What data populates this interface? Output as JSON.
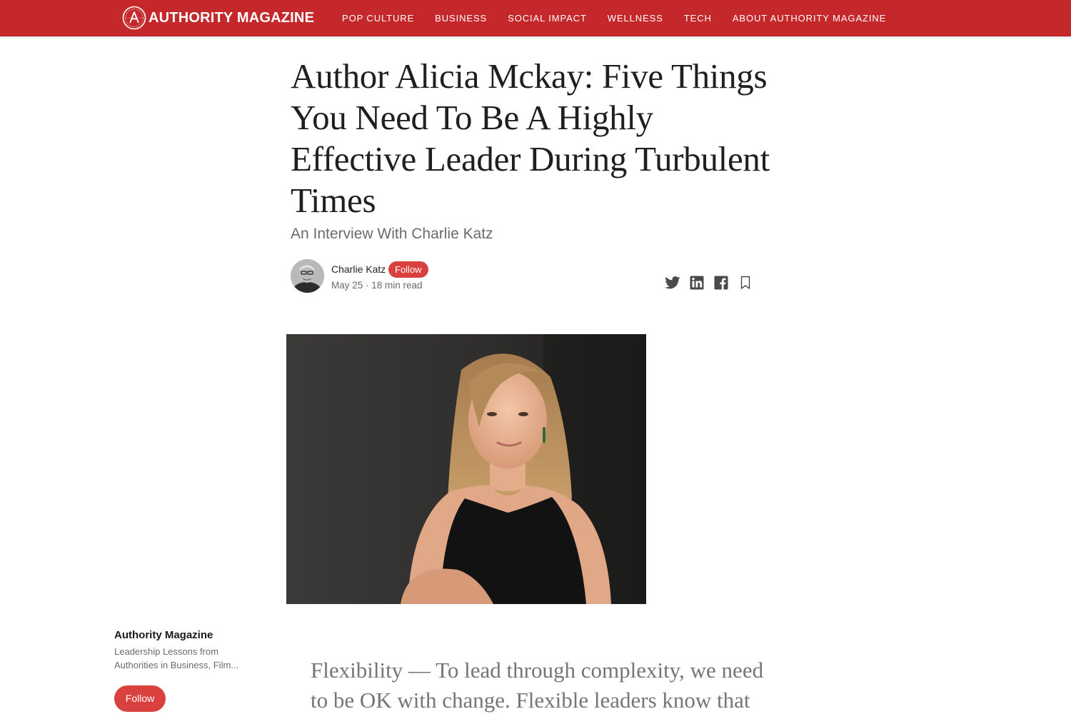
{
  "brand": {
    "name": "AUTHORITY MAGAZINE",
    "logo_icon": "authority-a-seal-icon",
    "color": "#c4282b"
  },
  "nav": {
    "items": [
      {
        "label": "POP CULTURE"
      },
      {
        "label": "BUSINESS"
      },
      {
        "label": "SOCIAL IMPACT"
      },
      {
        "label": "WELLNESS"
      },
      {
        "label": "TECH"
      },
      {
        "label": "ABOUT AUTHORITY MAGAZINE"
      }
    ]
  },
  "article": {
    "title": "Author Alicia Mckay: Five Things You Need To Be A Highly Effective Leader During Turbulent Times",
    "subtitle": "An Interview With Charlie Katz",
    "author": {
      "name": "Charlie Katz",
      "follow_label": "Follow",
      "date": "May 25",
      "read_time": "18 min read",
      "meta": "May 25 · 18 min read"
    },
    "share_icons": [
      "twitter-icon",
      "linkedin-icon",
      "facebook-icon",
      "bookmark-icon"
    ],
    "pull_quote": "Flexibility — To lead through complexity, we need to be OK with change. Flexible leaders know that"
  },
  "publication": {
    "name": "Authority Magazine",
    "description": "Leadership Lessons from Authorities in Business, Film...",
    "follow_label": "Follow"
  },
  "colors": {
    "accent_red": "#d9413f",
    "nav_red": "#c4282b",
    "text_primary": "#242424",
    "text_secondary": "#6b6b6b"
  }
}
